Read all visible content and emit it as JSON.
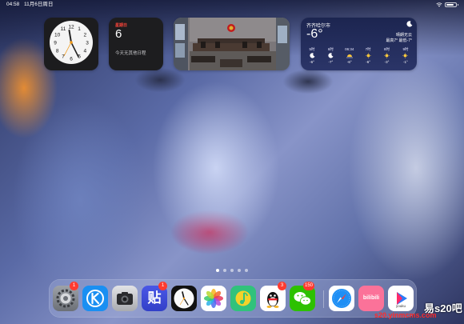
{
  "status_bar": {
    "time": "04:58",
    "date": "11月6日周日",
    "battery_level": 0.85
  },
  "widgets": {
    "clock": {
      "type": "analog-clock",
      "numerals": [
        "12",
        "1",
        "2",
        "3",
        "4",
        "5",
        "6",
        "7",
        "8",
        "9",
        "10",
        "11"
      ]
    },
    "calendar": {
      "weekday": "星期日",
      "day": "6",
      "no_events": "今天无其他日程"
    },
    "photo": {
      "subject": "courtroom-photo"
    },
    "weather": {
      "city": "齐齐哈尔市",
      "temperature": "-6°",
      "condition": "晴朗无云",
      "high_low": "最高7° 最低-7°",
      "forecast": [
        {
          "time": "5时",
          "icon": "moon-icon",
          "temp": "-6°"
        },
        {
          "time": "6时",
          "icon": "moon-icon",
          "temp": "-7°"
        },
        {
          "time": "06:34",
          "icon": "sunrise-icon",
          "temp": "-6°"
        },
        {
          "time": "7时",
          "icon": "sun-icon",
          "temp": "-6°"
        },
        {
          "time": "8时",
          "icon": "sun-icon",
          "temp": "-3°"
        },
        {
          "time": "9时",
          "icon": "sun-icon",
          "temp": "-1°"
        }
      ]
    }
  },
  "page_dots": {
    "count": 5,
    "active_index": 0
  },
  "dock": {
    "apps": [
      {
        "name": "Settings",
        "icon": "settings-icon",
        "badge": "1"
      },
      {
        "name": "Kugou Music",
        "icon": "kugou-icon",
        "badge": ""
      },
      {
        "name": "Camera",
        "icon": "camera-icon",
        "badge": ""
      },
      {
        "name": "Baidu Tieba",
        "icon": "tieba-icon",
        "badge": "1",
        "label": "贴"
      },
      {
        "name": "Clock",
        "icon": "clock-icon",
        "badge": ""
      },
      {
        "name": "Photos",
        "icon": "photos-icon",
        "badge": ""
      },
      {
        "name": "QQ Music",
        "icon": "qqmusic-icon",
        "badge": ""
      },
      {
        "name": "QQ",
        "icon": "qq-icon",
        "badge": "3"
      },
      {
        "name": "WeChat",
        "icon": "wechat-icon",
        "badge": "150"
      },
      {
        "name": "Safari",
        "icon": "safari-icon",
        "badge": ""
      },
      {
        "name": "bilibili",
        "icon": "bilibili-icon",
        "badge": "",
        "label": "bilibili"
      },
      {
        "name": "Youku",
        "icon": "youku-icon",
        "badge": "",
        "label": "youku"
      }
    ]
  },
  "watermark": {
    "text": "易s20吧",
    "url": "s20.yinmcms.com"
  },
  "colors": {
    "badge": "#ff3b30",
    "calendar_accent": "#ff453a"
  }
}
